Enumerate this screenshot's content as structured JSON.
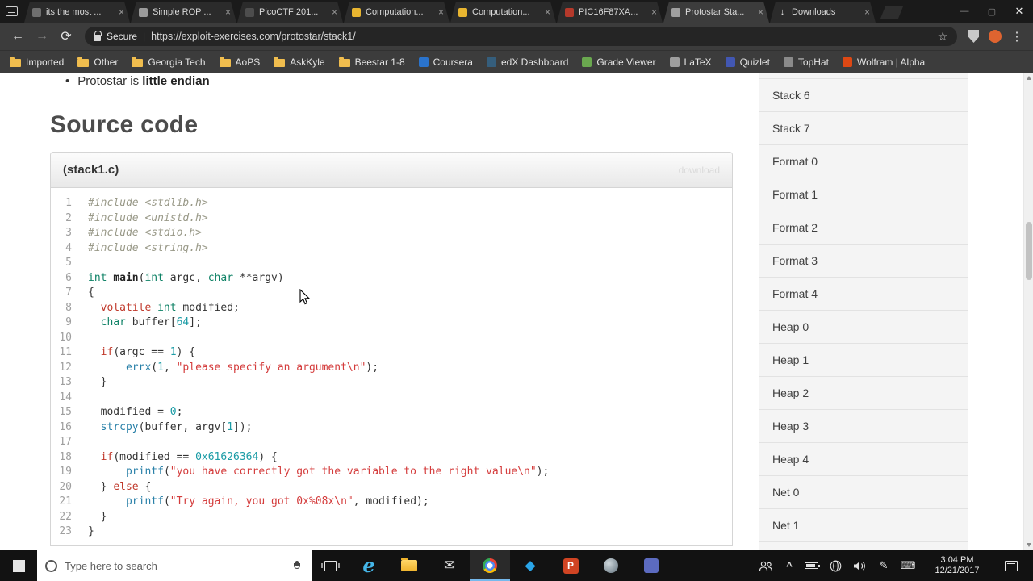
{
  "browser": {
    "window_controls": {
      "minimize": "—",
      "maximize": "▢",
      "close": "✕"
    },
    "icons": {
      "back": "←",
      "forward": "→",
      "reload": "⟳",
      "star": "☆",
      "menu": "⋮"
    },
    "tabs": [
      {
        "label": "its the most ...",
        "icon": "video-icon",
        "color": "#6f6f6f",
        "active": false
      },
      {
        "label": "Simple ROP ...",
        "icon": "page-icon",
        "color": "#9a9a9a",
        "active": false
      },
      {
        "label": "PicoCTF 201...",
        "icon": "flag-icon",
        "color": "#4d4d4d",
        "active": false
      },
      {
        "label": "Computation...",
        "icon": "course-icon",
        "color": "#e8b530",
        "active": false
      },
      {
        "label": "Computation...",
        "icon": "course-icon",
        "color": "#e8b530",
        "active": false
      },
      {
        "label": "PIC16F87XA...",
        "icon": "pdf-icon",
        "color": "#b5392b",
        "active": false
      },
      {
        "label": "Protostar Sta...",
        "icon": "site-icon",
        "color": "#a0a0a0",
        "active": true
      },
      {
        "label": "Downloads",
        "icon": "download-icon",
        "glyph": "↓",
        "color": "#e8e8e8",
        "active": false
      }
    ],
    "address_bar": {
      "secure_label": "Secure",
      "separator": "|",
      "url": "https://exploit-exercises.com/protostar/stack1/"
    },
    "bookmarks": [
      {
        "label": "Imported",
        "type": "folder"
      },
      {
        "label": "Other",
        "type": "folder"
      },
      {
        "label": "Georgia Tech",
        "type": "folder"
      },
      {
        "label": "AoPS",
        "type": "folder"
      },
      {
        "label": "AskKyle",
        "type": "folder"
      },
      {
        "label": "Beestar 1-8",
        "type": "folder"
      },
      {
        "label": "Coursera",
        "type": "favicon",
        "color": "#2a73cc"
      },
      {
        "label": "edX Dashboard",
        "type": "favicon",
        "color": "#355e7c"
      },
      {
        "label": "Grade Viewer",
        "type": "favicon",
        "color": "#6aa84f"
      },
      {
        "label": "LaTeX",
        "type": "favicon",
        "color": "#9e9e9e"
      },
      {
        "label": "Quizlet",
        "type": "favicon",
        "color": "#4257b2"
      },
      {
        "label": "TopHat",
        "type": "favicon",
        "color": "#8a8a8a"
      },
      {
        "label": "Wolfram | Alpha",
        "type": "favicon",
        "color": "#dd4814"
      }
    ]
  },
  "page": {
    "bullet_prefix": "Protostar is ",
    "bullet_strong": "little endian",
    "heading": "Source code",
    "code_header": {
      "title": "(stack1.c)",
      "download_label": "download"
    },
    "code_lines": [
      [
        {
          "t": "#include <stdlib.h>",
          "c": "cm"
        }
      ],
      [
        {
          "t": "#include <unistd.h>",
          "c": "cm"
        }
      ],
      [
        {
          "t": "#include <stdio.h>",
          "c": "cm"
        }
      ],
      [
        {
          "t": "#include <string.h>",
          "c": "cm"
        }
      ],
      [],
      [
        {
          "t": "int",
          "c": "kt"
        },
        {
          "t": " ",
          "c": "pl"
        },
        {
          "t": "main",
          "c": "fnm"
        },
        {
          "t": "(",
          "c": "pl"
        },
        {
          "t": "int",
          "c": "kt"
        },
        {
          "t": " argc, ",
          "c": "pl"
        },
        {
          "t": "char",
          "c": "kt"
        },
        {
          "t": " **argv)",
          "c": "pl"
        }
      ],
      [
        {
          "t": "{",
          "c": "pl"
        }
      ],
      [
        {
          "t": "  ",
          "c": "pl"
        },
        {
          "t": "volatile",
          "c": "kw"
        },
        {
          "t": " ",
          "c": "pl"
        },
        {
          "t": "int",
          "c": "kt"
        },
        {
          "t": " modified;",
          "c": "pl"
        }
      ],
      [
        {
          "t": "  ",
          "c": "pl"
        },
        {
          "t": "char",
          "c": "kt"
        },
        {
          "t": " buffer[",
          "c": "pl"
        },
        {
          "t": "64",
          "c": "num"
        },
        {
          "t": "];",
          "c": "pl"
        }
      ],
      [],
      [
        {
          "t": "  ",
          "c": "pl"
        },
        {
          "t": "if",
          "c": "kw"
        },
        {
          "t": "(argc == ",
          "c": "pl"
        },
        {
          "t": "1",
          "c": "num"
        },
        {
          "t": ") {",
          "c": "pl"
        }
      ],
      [
        {
          "t": "      ",
          "c": "pl"
        },
        {
          "t": "errx",
          "c": "fn"
        },
        {
          "t": "(",
          "c": "pl"
        },
        {
          "t": "1",
          "c": "num"
        },
        {
          "t": ", ",
          "c": "pl"
        },
        {
          "t": "\"please specify an argument\\n\"",
          "c": "str"
        },
        {
          "t": ");",
          "c": "pl"
        }
      ],
      [
        {
          "t": "  }",
          "c": "pl"
        }
      ],
      [],
      [
        {
          "t": "  modified = ",
          "c": "pl"
        },
        {
          "t": "0",
          "c": "num"
        },
        {
          "t": ";",
          "c": "pl"
        }
      ],
      [
        {
          "t": "  ",
          "c": "pl"
        },
        {
          "t": "strcpy",
          "c": "fn"
        },
        {
          "t": "(buffer, argv[",
          "c": "pl"
        },
        {
          "t": "1",
          "c": "num"
        },
        {
          "t": "]);",
          "c": "pl"
        }
      ],
      [],
      [
        {
          "t": "  ",
          "c": "pl"
        },
        {
          "t": "if",
          "c": "kw"
        },
        {
          "t": "(modified == ",
          "c": "pl"
        },
        {
          "t": "0x61626364",
          "c": "num"
        },
        {
          "t": ") {",
          "c": "pl"
        }
      ],
      [
        {
          "t": "      ",
          "c": "pl"
        },
        {
          "t": "printf",
          "c": "fn"
        },
        {
          "t": "(",
          "c": "pl"
        },
        {
          "t": "\"you have correctly got the variable to the right value\\n\"",
          "c": "str"
        },
        {
          "t": ");",
          "c": "pl"
        }
      ],
      [
        {
          "t": "  } ",
          "c": "pl"
        },
        {
          "t": "else",
          "c": "kw"
        },
        {
          "t": " {",
          "c": "pl"
        }
      ],
      [
        {
          "t": "      ",
          "c": "pl"
        },
        {
          "t": "printf",
          "c": "fn"
        },
        {
          "t": "(",
          "c": "pl"
        },
        {
          "t": "\"Try again, you got 0x%08x\\n\"",
          "c": "str"
        },
        {
          "t": ", modified);",
          "c": "pl"
        }
      ],
      [
        {
          "t": "  }",
          "c": "pl"
        }
      ],
      [
        {
          "t": "}",
          "c": "pl"
        }
      ]
    ],
    "sidebar_items": [
      "Stack 6",
      "Stack 7",
      "Format 0",
      "Format 1",
      "Format 2",
      "Format 3",
      "Format 4",
      "Heap 0",
      "Heap 1",
      "Heap 2",
      "Heap 3",
      "Heap 4",
      "Net 0",
      "Net 1"
    ]
  },
  "taskbar": {
    "search_placeholder": "Type here to search",
    "clock": {
      "time": "3:04 PM",
      "date": "12/21/2017"
    },
    "apps": [
      {
        "name": "edge",
        "glyph": "e",
        "active": false
      },
      {
        "name": "file-explorer",
        "glyph": "",
        "active": false
      },
      {
        "name": "mail",
        "glyph": "✉",
        "active": false
      },
      {
        "name": "chrome",
        "glyph": "",
        "active": true
      },
      {
        "name": "mixed-reality",
        "glyph": "◆",
        "active": false
      },
      {
        "name": "powerpoint",
        "glyph": "P",
        "active": false
      },
      {
        "name": "steam",
        "glyph": "",
        "active": false
      },
      {
        "name": "app",
        "glyph": "",
        "active": false
      }
    ]
  }
}
